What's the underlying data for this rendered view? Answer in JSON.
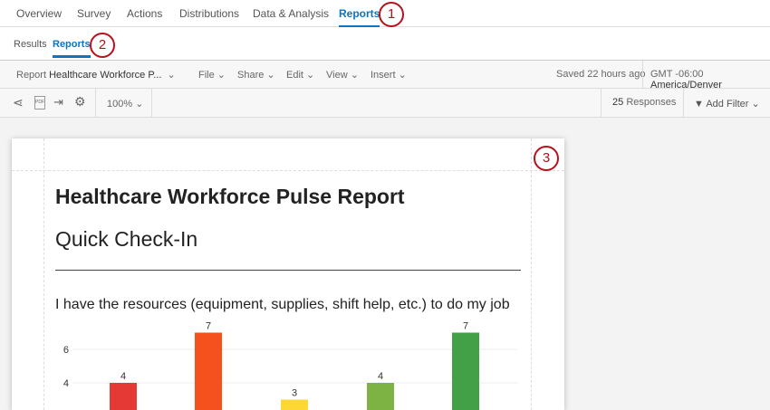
{
  "top_nav": {
    "items": [
      "Overview",
      "Survey",
      "Actions",
      "Distributions",
      "Data & Analysis",
      "Reports"
    ],
    "active": "Reports"
  },
  "sub_nav": {
    "items": [
      "Results",
      "Reports"
    ],
    "active": "Reports"
  },
  "toolbar": {
    "report_prefix": "Report",
    "report_name": "Healthcare Workforce P...",
    "menus": [
      "File",
      "Share",
      "Edit",
      "View",
      "Insert"
    ],
    "saved": "Saved 22 hours ago",
    "tz_offset": "GMT -06:00",
    "tz_name": "America/Denver"
  },
  "toolbar2": {
    "zoom": "100%",
    "responses_count": "25",
    "responses_label": "Responses",
    "add_filter": "Add Filter"
  },
  "badges": [
    "1",
    "2",
    "3"
  ],
  "report": {
    "title": "Healthcare Workforce Pulse Report",
    "section": "Quick Check-In",
    "question": "I have the resources (equipment, supplies, shift help, etc.) to do my job"
  },
  "chart_data": {
    "type": "bar",
    "title": "I have the resources (equipment, supplies, shift help, etc.) to do my job",
    "y_ticks": [
      "4",
      "6"
    ],
    "values": [
      4,
      7,
      3,
      4,
      7
    ],
    "labels": [
      "4",
      "7",
      "3",
      "4",
      "7"
    ],
    "colors": [
      "#e53935",
      "#f4511e",
      "#fdd835",
      "#7cb342",
      "#43a047"
    ]
  }
}
